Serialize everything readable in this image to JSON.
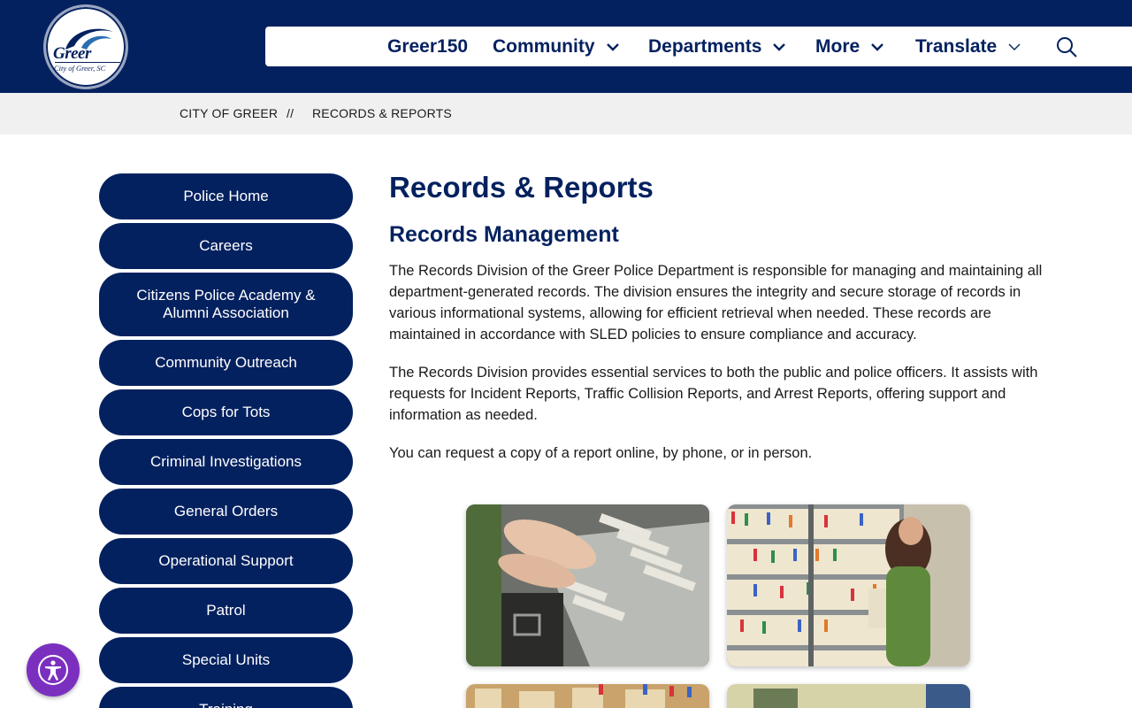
{
  "logo": {
    "name": "Greer",
    "subtitle": "City of Greer, SC"
  },
  "nav": {
    "items": [
      {
        "label": "Greer150",
        "has_dropdown": false
      },
      {
        "label": "Community",
        "has_dropdown": true
      },
      {
        "label": "Departments",
        "has_dropdown": true
      },
      {
        "label": "More",
        "has_dropdown": true
      },
      {
        "label": "Translate",
        "has_dropdown": true
      }
    ],
    "search_icon": "search-icon"
  },
  "breadcrumb": {
    "home": "CITY OF GREER",
    "separator": "//",
    "current": "RECORDS & REPORTS"
  },
  "sidebar": {
    "items": [
      {
        "label": "Police Home"
      },
      {
        "label": "Careers"
      },
      {
        "label": "Citizens Police Academy & Alumni Association"
      },
      {
        "label": "Community Outreach"
      },
      {
        "label": "Cops for Tots"
      },
      {
        "label": "Criminal Investigations"
      },
      {
        "label": "General Orders"
      },
      {
        "label": "Operational Support"
      },
      {
        "label": "Patrol"
      },
      {
        "label": "Special Units"
      },
      {
        "label": "Training"
      }
    ]
  },
  "main": {
    "title": "Records & Reports",
    "section_title": "Records Management",
    "paragraphs": [
      "The Records Division of the Greer Police Department is responsible for managing and maintaining all department-generated records. The division ensures the integrity and secure storage of records in various informational systems, allowing for efficient retrieval when needed. These records are maintained in accordance with SLED policies to ensure compliance and accuracy.",
      "The Records Division provides essential services to both the public and police officers. It assists with requests for Incident Reports, Traffic Collision Reports, and Arrest Reports, offering support and information as needed.",
      "You can request a copy of a report online, by phone, or in person."
    ]
  },
  "colors": {
    "brand_navy": "#04215f",
    "crumb_bg": "#f0f0f0",
    "accessibility_purple": "#7b2fbf"
  }
}
